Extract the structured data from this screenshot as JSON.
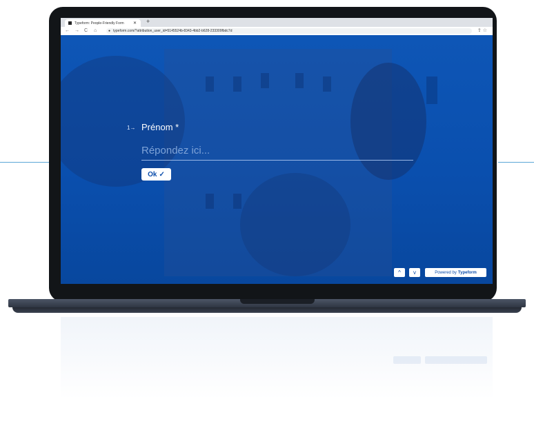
{
  "browser": {
    "tab_title": "Typeform: People-Friendly Form",
    "tab_close": "✕",
    "new_tab": "+",
    "nav_back": "←",
    "nav_forward": "→",
    "nav_reload": "C",
    "nav_home": "⌂",
    "url": "typeform.com/?attribution_user_id=5145524b-8343-4bb2-b628-233309fbdc7d",
    "share_icon": "⇪",
    "star_icon": "☆"
  },
  "form": {
    "question_number": "1→",
    "question_title": "Prénom *",
    "answer_placeholder": "Répondez ici...",
    "ok_label": "Ok",
    "ok_check": "✓"
  },
  "footer": {
    "up_label": "^",
    "down_label": "v",
    "powered_prefix": "Powered by",
    "powered_brand": "Typeform"
  },
  "colors": {
    "accent": "#0b4dab",
    "screen_bg": "#0b4dab",
    "laptop_frame": "#121518"
  }
}
